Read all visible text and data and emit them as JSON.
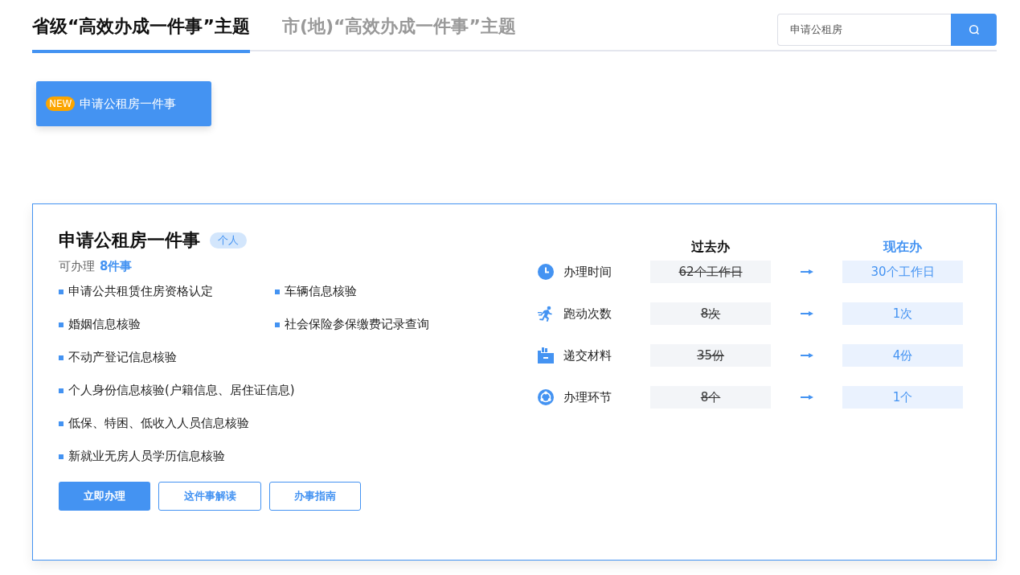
{
  "tabs": [
    {
      "label": "省级“高效办成一件事”主题",
      "selected": true
    },
    {
      "label": "市(地)“高效办成一件事”主题",
      "selected": false
    }
  ],
  "search": {
    "value": "申请公租房"
  },
  "topics": [
    {
      "badge": "NEW",
      "label": "申请公租房一件事",
      "selected": true
    }
  ],
  "card": {
    "title": "申请公租房一件事",
    "tag": "个人",
    "count_label": "可办理",
    "count": "8件事",
    "items": [
      "申请公共租赁住房资格认定",
      "车辆信息核验",
      "婚姻信息核验",
      "社会保险参保缴费记录查询",
      "不动产登记信息核验",
      "个人身份信息核验(户籍信息、居住证信息)",
      "低保、特困、低收入人员信息核验",
      "新就业无房人员学历信息核验"
    ],
    "buttons": [
      {
        "label": "立即办理",
        "kind": "primary"
      },
      {
        "label": "这件事解读",
        "kind": "outline"
      },
      {
        "label": "办事指南",
        "kind": "outline"
      }
    ],
    "compare": {
      "before_header": "过去办",
      "after_header": "现在办",
      "rows": [
        {
          "label": "办理时间",
          "before": "62个工作日",
          "after": "30个工作日"
        },
        {
          "label": "跑动次数",
          "before": "8次",
          "after": "1次"
        },
        {
          "label": "递交材料",
          "before": "35份",
          "after": "4份"
        },
        {
          "label": "办理环节",
          "before": "8个",
          "after": "1个"
        }
      ]
    }
  }
}
